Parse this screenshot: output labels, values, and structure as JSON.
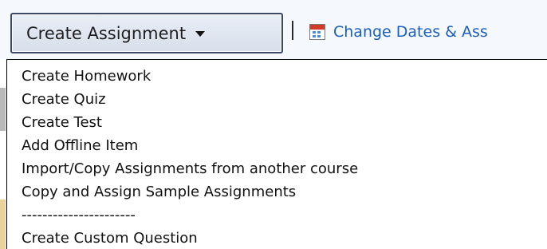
{
  "toolbar": {
    "create_label": "Create Assignment",
    "change_label": "Change Dates & Ass"
  },
  "menu": {
    "items": [
      "Create Homework",
      "Create Quiz",
      "Create Test",
      "Add Offline Item",
      "Import/Copy Assignments from another course",
      "Copy and Assign Sample Assignments",
      "----------------------",
      "Create Custom Question"
    ]
  },
  "icons": {
    "dropdown": "chevron-down-icon",
    "calendar": "calendar-icon"
  },
  "colors": {
    "link": "#1a5fc0",
    "button_border": "#3a4a66",
    "toolbar_bg": "#f5f8fc"
  }
}
